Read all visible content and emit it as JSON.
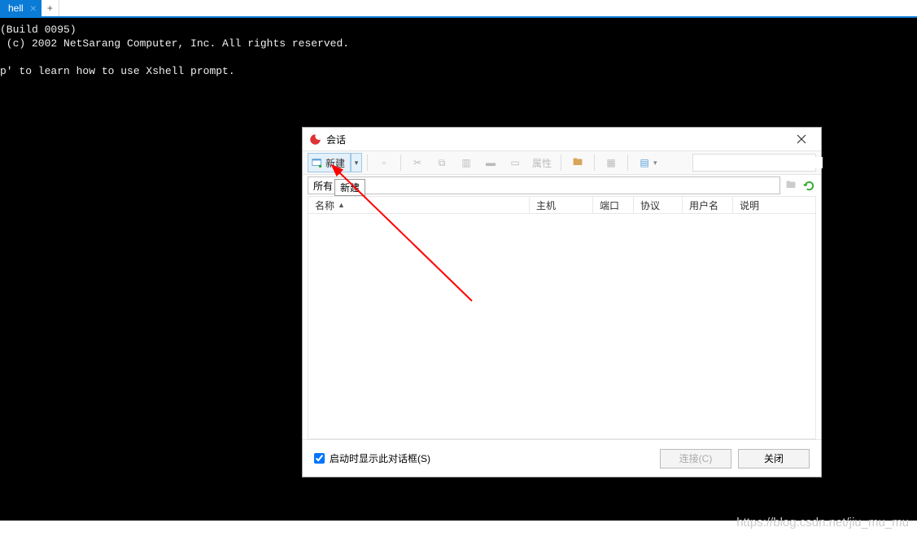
{
  "tabbar": {
    "active_tab": "hell",
    "add_symbol": "+"
  },
  "terminal": {
    "line1": "(Build 0095)",
    "line2": " (c) 2002 NetSarang Computer, Inc. All rights reserved.",
    "line3": "",
    "line4": "p' to learn how to use Xshell prompt."
  },
  "dialog": {
    "title": "会话",
    "toolbar": {
      "new_label": "新建",
      "props_label": "属性"
    },
    "tooltip": "新建",
    "path_prefix": "所有",
    "columns": {
      "name": "名称",
      "host": "主机",
      "port": "端口",
      "proto": "协议",
      "user": "用户名",
      "desc": "说明"
    },
    "chk_label": "启动时显示此对话框(S)",
    "btn_connect": "连接(C)",
    "btn_close": "关闭"
  },
  "watermark": "https://blog.csdn.net/jiu_mu_mu"
}
